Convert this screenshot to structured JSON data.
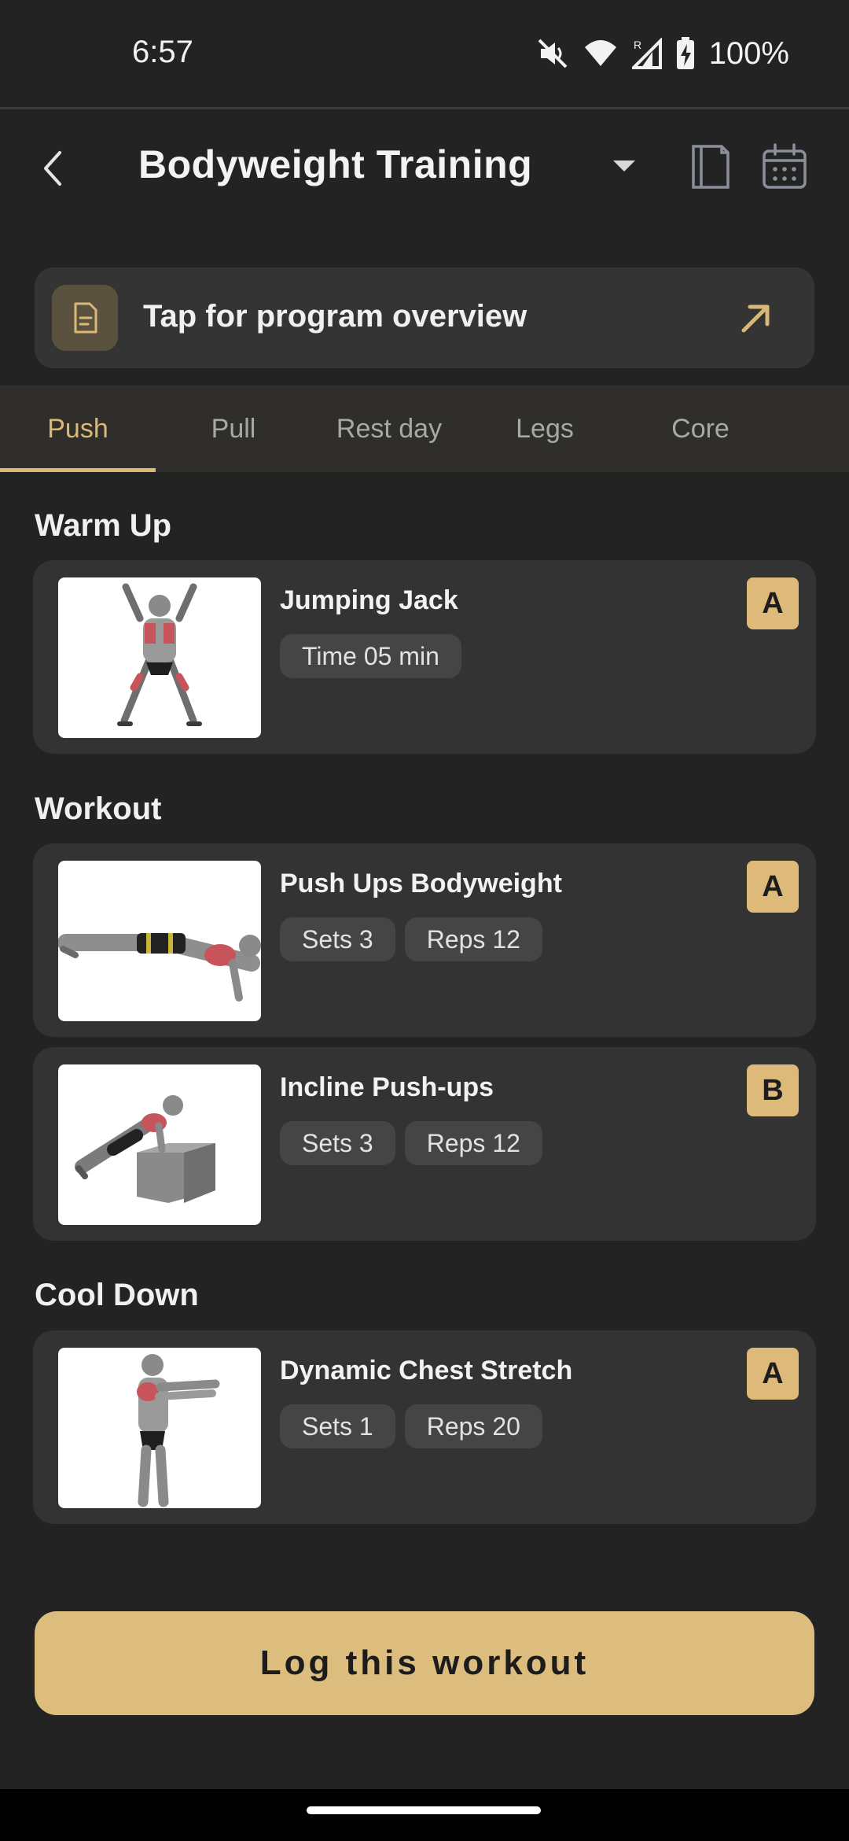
{
  "status_bar": {
    "time": "6:57",
    "battery": "100%",
    "icons": [
      "mute-icon",
      "wifi-icon",
      "signal-icon",
      "battery-charging-icon"
    ]
  },
  "app_bar": {
    "title": "Bodyweight Training",
    "icons": [
      "back-arrow-icon",
      "dropdown-caret-icon",
      "notes-icon",
      "calendar-icon"
    ]
  },
  "overview": {
    "label": "Tap for program overview",
    "icons": [
      "document-icon",
      "arrow-up-right-icon"
    ]
  },
  "tabs": [
    {
      "label": "Push",
      "active": true
    },
    {
      "label": "Pull",
      "active": false
    },
    {
      "label": "Rest day",
      "active": false
    },
    {
      "label": "Legs",
      "active": false
    },
    {
      "label": "Core",
      "active": false
    }
  ],
  "sections": {
    "warmup": {
      "title": "Warm Up",
      "exercises": [
        {
          "name": "Jumping Jack",
          "chips": [
            "Time 05 min"
          ],
          "badge": "A"
        }
      ]
    },
    "workout": {
      "title": "Workout",
      "exercises": [
        {
          "name": "Push Ups Bodyweight",
          "chips": [
            "Sets 3",
            "Reps 12"
          ],
          "badge": "A"
        },
        {
          "name": "Incline Push-ups",
          "chips": [
            "Sets 3",
            "Reps 12"
          ],
          "badge": "B"
        }
      ]
    },
    "cooldown": {
      "title": "Cool Down",
      "exercises": [
        {
          "name": "Dynamic Chest Stretch",
          "chips": [
            "Sets 1",
            "Reps 20"
          ],
          "badge": "A"
        }
      ]
    }
  },
  "log_button": {
    "label": "Log this workout"
  },
  "colors": {
    "background": "#232323",
    "card": "#333333",
    "accent": "#dcbd7e",
    "chip": "#454545",
    "tab_bar": "#2f2e2a"
  }
}
